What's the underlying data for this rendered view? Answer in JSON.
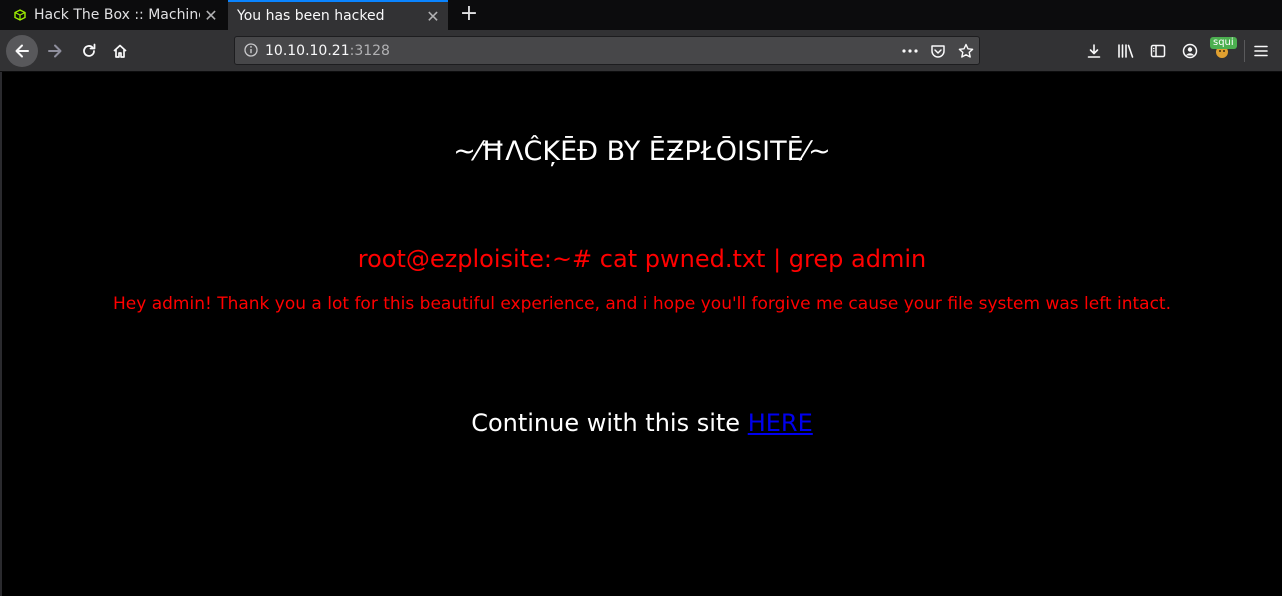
{
  "browser": {
    "tabs": [
      {
        "label": "Hack The Box :: Machines",
        "active": false
      },
      {
        "label": "You has been hacked",
        "active": true
      }
    ],
    "url": {
      "host": "10.10.10.21",
      "port": ":3128"
    },
    "extension_badge": "squi",
    "accent_color": "#0a84ff"
  },
  "page": {
    "title": "~⁄ĦΛĈĶĒĐ BY ĒƵPŁŌISITĒ⁄~",
    "prompt": "root@ezploisite:~# cat pwned.txt | grep admin",
    "message": "Hey admin! Thank you a lot for this beautiful experience, and i hope you'll forgive me cause your file system was left intact.",
    "continue_text": "Continue with this site",
    "continue_link": "HERE",
    "colors": {
      "background": "#000000",
      "title": "#ffffff",
      "terminal": "#ff0000",
      "link": "#0000ee"
    }
  }
}
